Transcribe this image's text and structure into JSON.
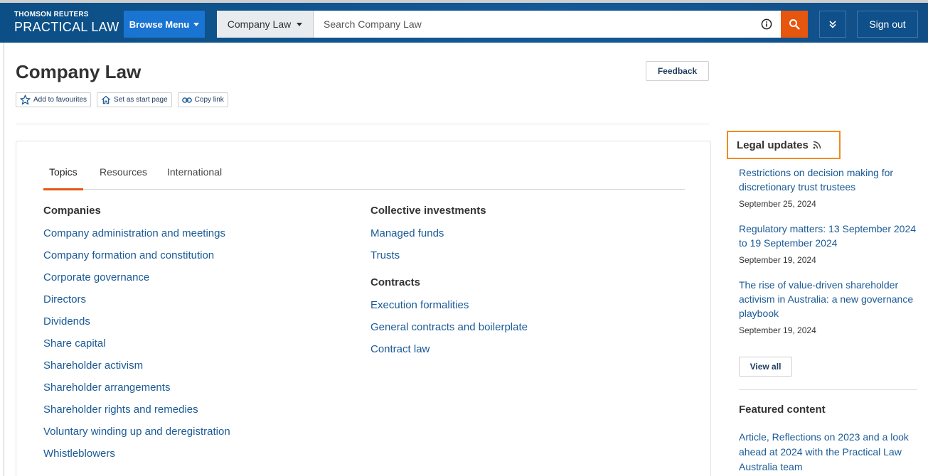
{
  "header": {
    "brand_top": "THOMSON REUTERS",
    "brand_main": "PRACTICAL LAW",
    "browse_menu": "Browse Menu",
    "practice_area": "Company Law",
    "search_placeholder": "Search Company Law",
    "sign_out": "Sign out"
  },
  "page": {
    "title": "Company Law",
    "feedback": "Feedback",
    "actions": {
      "favourites": "Add to favourites",
      "start_page": "Set as start page",
      "copy_link": "Copy link"
    }
  },
  "tabs": [
    {
      "label": "Topics",
      "active": true
    },
    {
      "label": "Resources",
      "active": false
    },
    {
      "label": "International",
      "active": false
    }
  ],
  "topics": {
    "left": [
      {
        "heading": "Companies",
        "links": [
          "Company administration and meetings",
          "Company formation and constitution",
          "Corporate governance",
          "Directors",
          "Dividends",
          "Share capital",
          "Shareholder activism",
          "Shareholder arrangements",
          "Shareholder rights and remedies",
          "Voluntary winding up and deregistration",
          "Whistleblowers"
        ]
      }
    ],
    "right": [
      {
        "heading": "Collective investments",
        "links": [
          "Managed funds",
          "Trusts"
        ]
      },
      {
        "heading": "Contracts",
        "links": [
          "Execution formalities",
          "General contracts and boilerplate",
          "Contract law"
        ]
      }
    ]
  },
  "sidebar": {
    "legal_updates_title": "Legal updates",
    "updates": [
      {
        "title": "Restrictions on decision making for discretionary trust trustees",
        "date": "September 25, 2024"
      },
      {
        "title": "Regulatory matters: 13 September 2024 to 19 September 2024",
        "date": "September 19, 2024"
      },
      {
        "title": "The rise of value-driven shareholder activism in Australia: a new governance playbook",
        "date": "September 19, 2024"
      }
    ],
    "view_all": "View all",
    "featured_title": "Featured content",
    "featured_link": "Article, Reflections on 2023 and a look ahead at 2024 with the Practical Law Australia team"
  },
  "icons": {
    "info": "info-icon",
    "search": "search-icon",
    "expand": "double-chevron-down-icon",
    "favourite": "star-icon",
    "home": "home-icon",
    "link": "link-icon",
    "rss": "rss-icon"
  },
  "colors": {
    "header_blue": "#135997",
    "browse_blue": "#1a74d1",
    "search_orange": "#e6560e",
    "link_blue": "#1a5a96",
    "highlight_orange": "#f08c1f"
  }
}
